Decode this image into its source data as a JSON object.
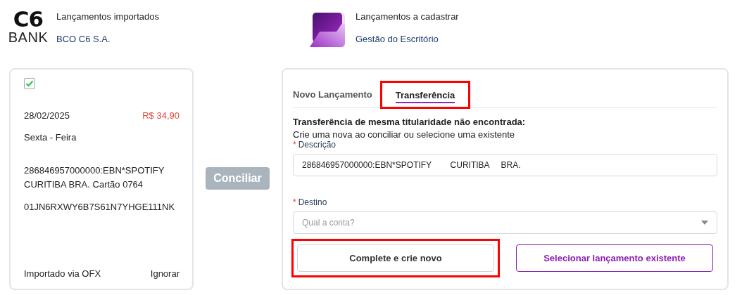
{
  "source": {
    "logo": {
      "main": "C6",
      "sub": "BANK"
    },
    "title": "Lançamentos importados",
    "name": "BCO C6 S.A."
  },
  "target": {
    "title": "Lançamentos a cadastrar",
    "name": "Gestão do Escritório"
  },
  "imported_entry": {
    "checked": true,
    "date": "28/02/2025",
    "amount": "R$ 34,90",
    "weekday": "Sexta - Feira",
    "description": "286846957000000:EBN*SPOTIFY CURITIBA BRA. Cartão 0764",
    "code": "01JN6RXWY6B7S61N7YHGE111NK",
    "origin": "Importado via OFX",
    "ignore_link": "Ignorar"
  },
  "reconcile_button": {
    "label": "Conciliar",
    "disabled": true
  },
  "tabs": [
    {
      "label": "Novo Lançamento",
      "selected": false,
      "highlighted": false
    },
    {
      "label": "Transferência",
      "selected": true,
      "highlighted": true
    }
  ],
  "message": {
    "title": "Transferência de mesma titularidade não encontrada:",
    "text": "Crie uma nova ao conciliar ou selecione uma existente"
  },
  "fields": [
    {
      "kind": "text",
      "label": "Descrição",
      "required_mark": "*",
      "value": "286846957000000:EBN*SPOTIFY        CURITIBA     BRA."
    },
    {
      "kind": "select",
      "label": "Destino",
      "required_mark": "*",
      "placeholder": "Qual a conta?"
    }
  ],
  "buttons": [
    {
      "label": "Complete e crie novo",
      "kind": "default",
      "highlighted": true
    },
    {
      "label": "Selecionar lançamento existente",
      "kind": "primary-outline",
      "highlighted": false
    }
  ]
}
